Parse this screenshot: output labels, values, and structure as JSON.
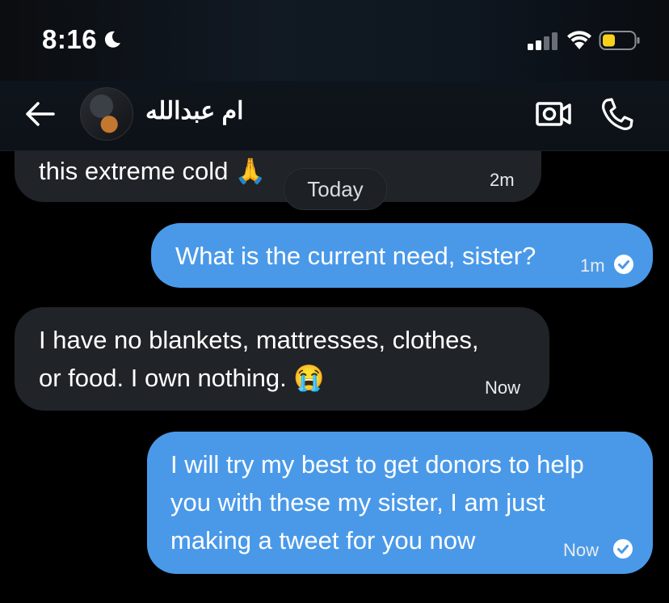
{
  "status_bar": {
    "time": "8:16"
  },
  "header": {
    "contact_name": "ام عبدالله"
  },
  "date_separator": "Today",
  "messages": [
    {
      "direction": "incoming",
      "text": "this extreme cold 🙏",
      "time": "2m"
    },
    {
      "direction": "outgoing",
      "text": "What is the current need, sister?",
      "time": "1m",
      "read": true
    },
    {
      "direction": "incoming",
      "text": "I have no blankets, mattresses, clothes,\nor food. I own nothing. 😭",
      "time": "Now"
    },
    {
      "direction": "outgoing",
      "text": "I will try my best to get donors to help\nyou with these my sister, I am just\nmaking a tweet for you now",
      "time": "Now",
      "read": true
    }
  ],
  "colors": {
    "outgoing_bubble": "#4a99e9",
    "incoming_bubble": "#202327",
    "background": "#000000"
  },
  "icons": [
    "moon-icon",
    "cellular-signal-icon",
    "wifi-icon",
    "battery-icon",
    "back-arrow-icon",
    "video-call-icon",
    "phone-call-icon",
    "read-check-icon"
  ]
}
